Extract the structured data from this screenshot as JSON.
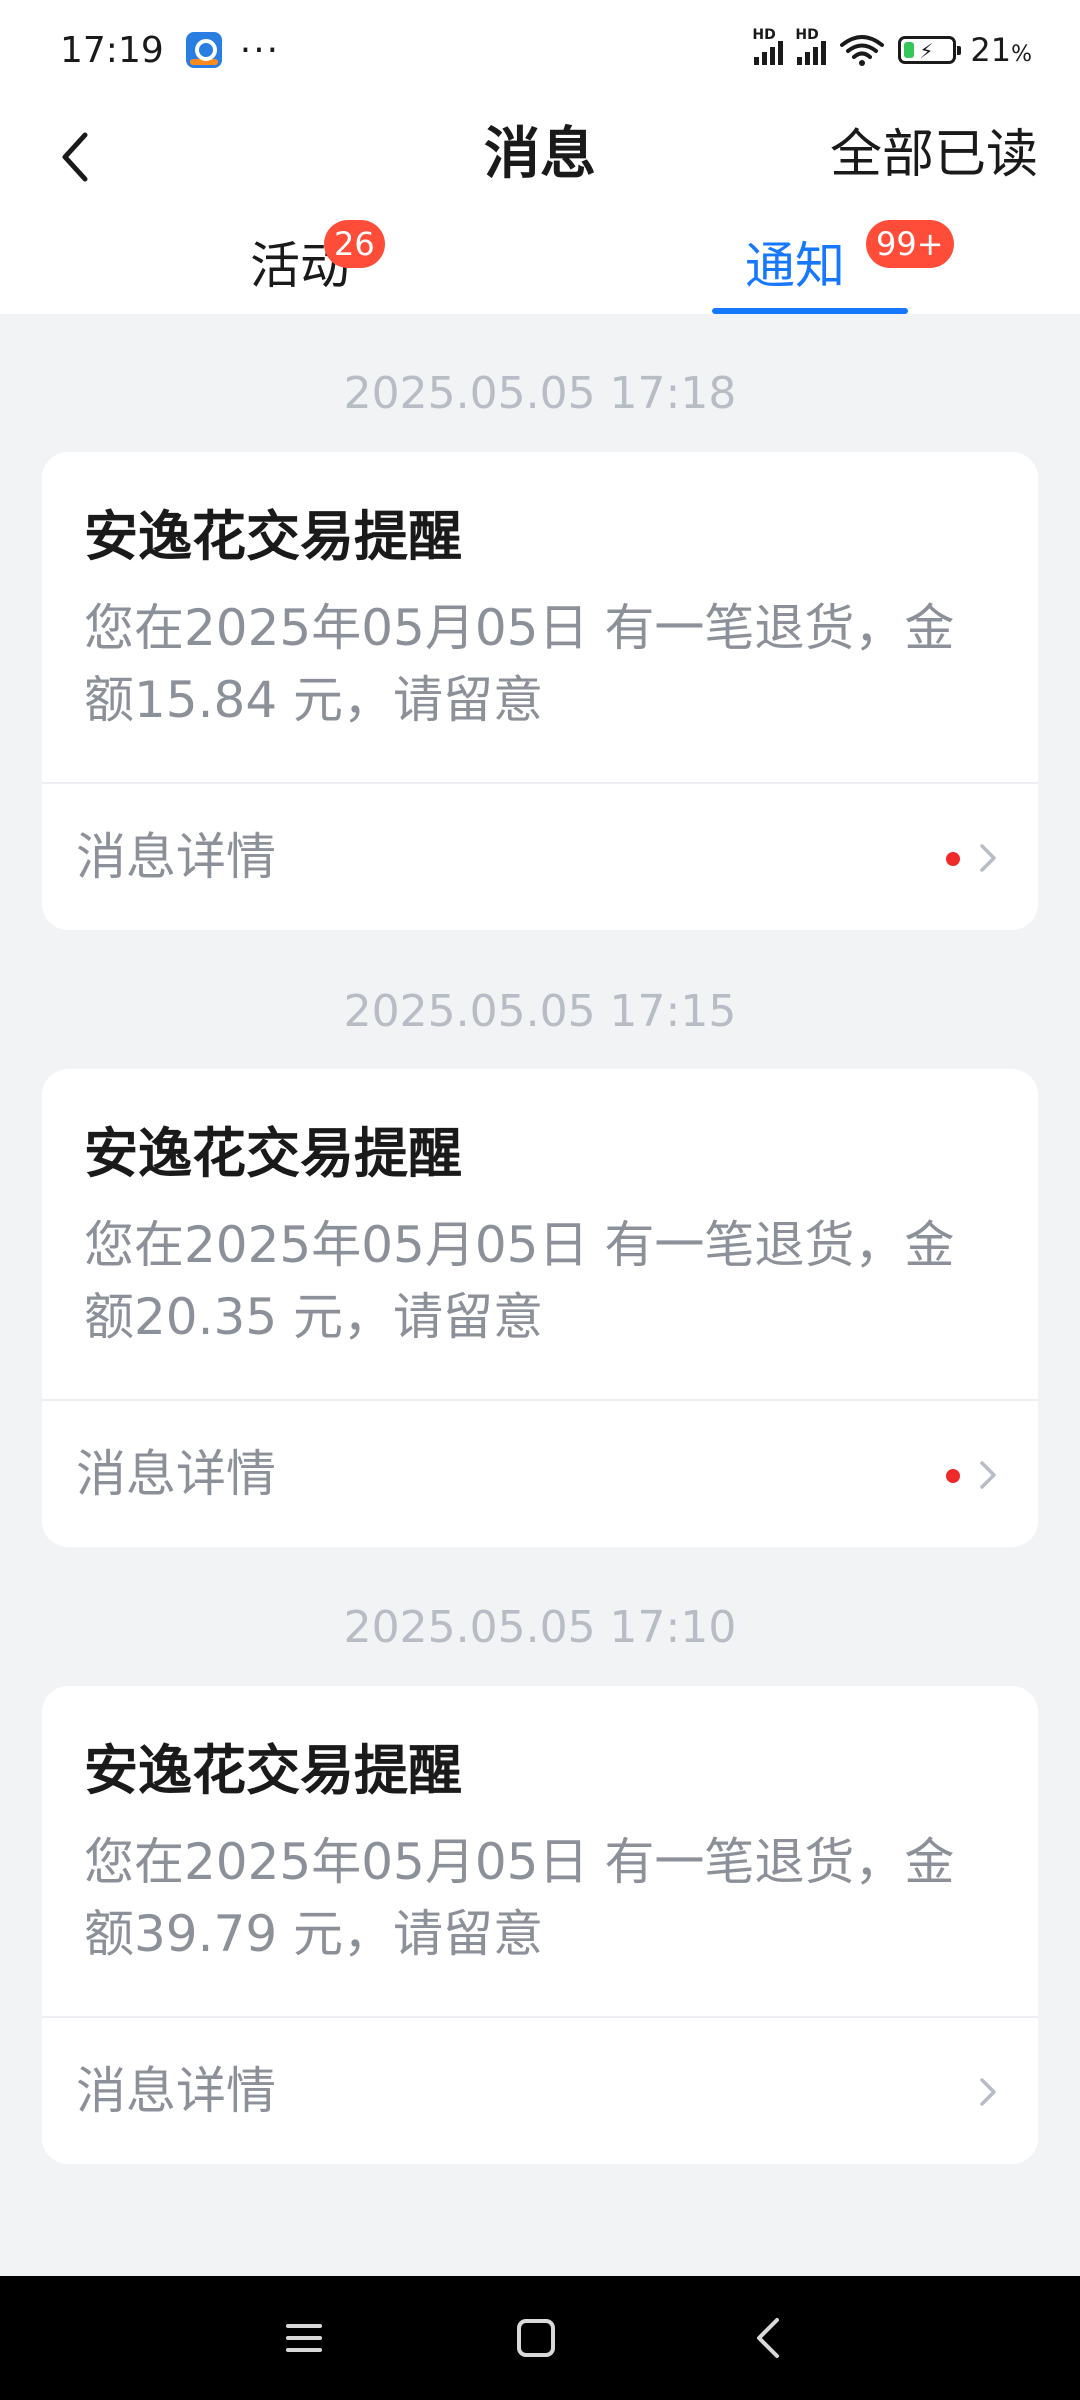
{
  "status_bar": {
    "time": "17:19",
    "more": "···",
    "signal_label": "HD",
    "battery_percent": "21",
    "battery_unit": "%",
    "battery_level": 0.21
  },
  "header": {
    "title": "消息",
    "mark_all_read": "全部已读"
  },
  "tabs": [
    {
      "label": "活动",
      "badge": "26",
      "active": false
    },
    {
      "label": "通知",
      "badge": "99+",
      "active": true
    }
  ],
  "notifications": [
    {
      "timestamp": "2025.05.05 17:18",
      "title": "安逸花交易提醒",
      "body": "您在2025年05月05日 有一笔退货，金额15.84 元，请留意",
      "details_label": "消息详情",
      "unread": true
    },
    {
      "timestamp": "2025.05.05 17:15",
      "title": "安逸花交易提醒",
      "body": "您在2025年05月05日 有一笔退货，金额20.35 元，请留意",
      "details_label": "消息详情",
      "unread": true
    },
    {
      "timestamp": "2025.05.05 17:10",
      "title": "安逸花交易提醒",
      "body": "您在2025年05月05日 有一笔退货，金额39.79 元，请留意",
      "details_label": "消息详情",
      "unread": false
    }
  ],
  "colors": {
    "accent": "#1677ff",
    "badge": "#ff4d3a",
    "unread_dot": "#ee2a2a",
    "background": "#f2f3f5"
  },
  "icons": {
    "back": "chevron-left-icon",
    "details": "chevron-right-icon",
    "nav_menu": "menu-icon",
    "nav_home": "home-square-icon",
    "nav_back": "back-triangle-icon"
  }
}
